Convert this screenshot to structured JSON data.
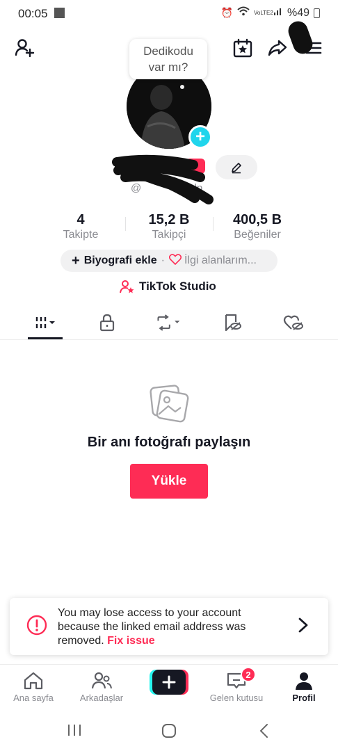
{
  "status_bar": {
    "time": "00:05",
    "battery": "%49",
    "network": "VoLTE2"
  },
  "header": {
    "bubble_text_line1": "Dedikodu",
    "bubble_text_line2": "var mı?",
    "username_partial": "@",
    "handle_tail": "klp"
  },
  "stats": [
    {
      "value": "4",
      "label": "Takipte"
    },
    {
      "value": "15,2 B",
      "label": "Takipçi"
    },
    {
      "value": "400,5 B",
      "label": "Beğeniler"
    }
  ],
  "bio": {
    "add_bio": "Biyografi ekle",
    "separator": "·",
    "interests": "İlgi alanlarım..."
  },
  "studio": {
    "label": "TikTok Studio"
  },
  "empty_state": {
    "title": "Bir anı fotoğrafı paylaşın",
    "button": "Yükle"
  },
  "alert": {
    "message": "You may lose access to your account because the linked email address was removed.",
    "action": "Fix issue"
  },
  "nav": {
    "home": "Ana sayfa",
    "friends": "Arkadaşlar",
    "inbox": "Gelen kutusu",
    "inbox_badge": "2",
    "profile": "Profil"
  },
  "colors": {
    "accent": "#fe2c55",
    "cyan": "#20d5ec",
    "text": "#161823",
    "muted": "#8a8b91"
  }
}
